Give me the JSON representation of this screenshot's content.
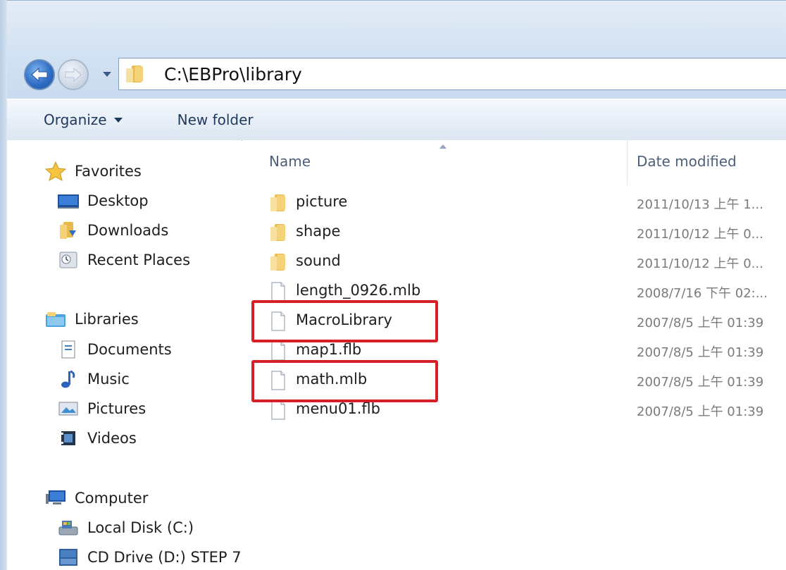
{
  "address": {
    "path": "C:\\EBPro\\library"
  },
  "toolbar": {
    "organize_label": "Organize",
    "new_folder_label": "New folder"
  },
  "columns": {
    "name": "Name",
    "date_modified": "Date modified"
  },
  "navigation": {
    "favorites": {
      "label": "Favorites",
      "items": [
        {
          "label": "Desktop",
          "icon": "desktop-icon"
        },
        {
          "label": "Downloads",
          "icon": "downloads-icon"
        },
        {
          "label": "Recent Places",
          "icon": "recent-places-icon"
        }
      ]
    },
    "libraries": {
      "label": "Libraries",
      "items": [
        {
          "label": "Documents",
          "icon": "documents-icon"
        },
        {
          "label": "Music",
          "icon": "music-icon"
        },
        {
          "label": "Pictures",
          "icon": "pictures-icon"
        },
        {
          "label": "Videos",
          "icon": "videos-icon"
        }
      ]
    },
    "computer": {
      "label": "Computer",
      "items": [
        {
          "label": "Local Disk (C:)",
          "icon": "local-disk-icon"
        },
        {
          "label": "CD Drive (D:) STEP 7",
          "icon": "cd-drive-icon"
        }
      ]
    }
  },
  "files": [
    {
      "name": "picture",
      "type": "folder",
      "date": "2011/10/13 上午 1..."
    },
    {
      "name": "shape",
      "type": "folder",
      "date": "2011/10/12 上午 0..."
    },
    {
      "name": "sound",
      "type": "folder",
      "date": "2011/10/12 上午 0..."
    },
    {
      "name": "length_0926.mlb",
      "type": "file",
      "date": "2008/7/16 下午 02:..."
    },
    {
      "name": "MacroLibrary",
      "type": "file",
      "date": "2007/8/5 上午 01:39",
      "highlighted": true
    },
    {
      "name": "map1.flb",
      "type": "file",
      "date": "2007/8/5 上午 01:39"
    },
    {
      "name": "math.mlb",
      "type": "file",
      "date": "2007/8/5 上午 01:39",
      "highlighted": true
    },
    {
      "name": "menu01.flb",
      "type": "file",
      "date": "2007/8/5 上午 01:39"
    }
  ],
  "colors": {
    "highlight": "#d61f26",
    "folder": "#f2c14e",
    "nav_back": "#2f6fc6"
  }
}
